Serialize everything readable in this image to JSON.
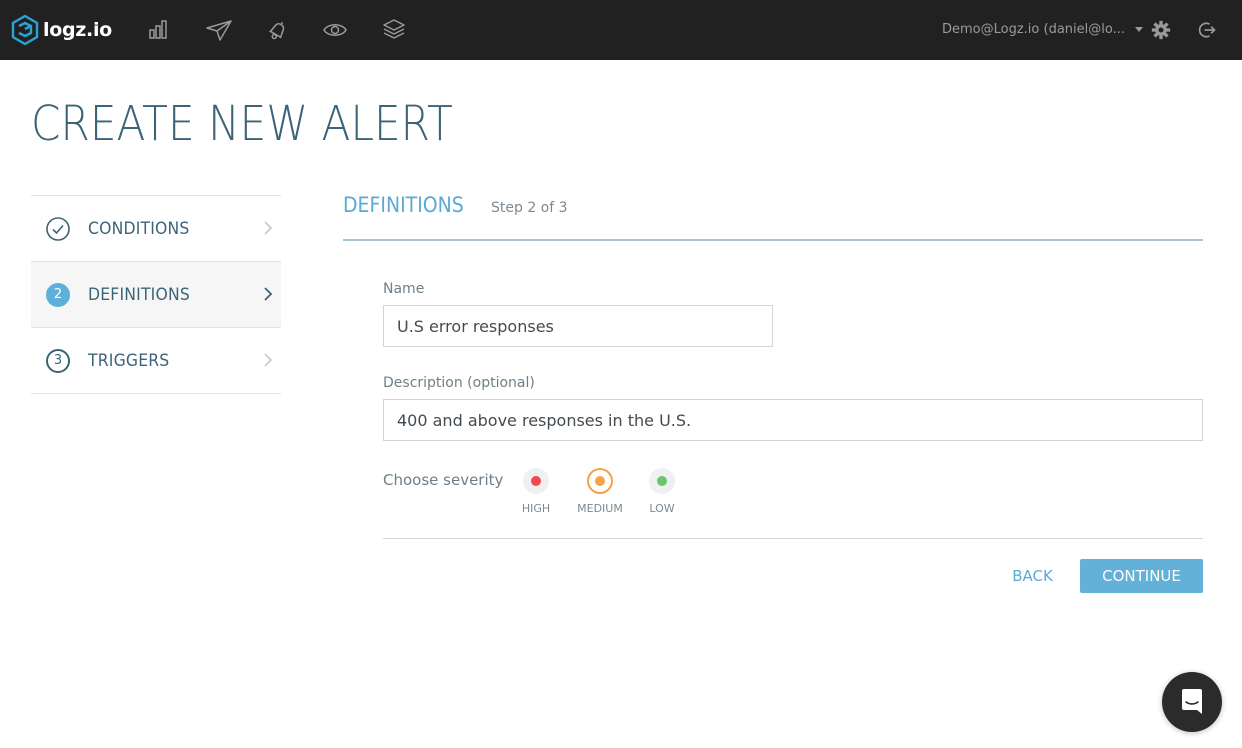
{
  "topbar": {
    "brand": "logz.io",
    "nav_icons": [
      "bar-chart-icon",
      "paper-plane-icon",
      "bell-icon",
      "eye-icon",
      "layers-icon"
    ],
    "account_label": "Demo@Logz.io (daniel@lo...",
    "settings_icon": "gear-icon",
    "logout_icon": "logout-icon"
  },
  "page": {
    "title": "CREATE NEW ALERT"
  },
  "steps": [
    {
      "label": "CONDITIONS",
      "badge": "✓",
      "state": "completed"
    },
    {
      "label": "DEFINITIONS",
      "badge": "2",
      "state": "active"
    },
    {
      "label": "TRIGGERS",
      "badge": "3",
      "state": "pending"
    }
  ],
  "section": {
    "title": "DEFINITIONS",
    "step_text": "Step 2 of 3"
  },
  "form": {
    "name_label": "Name",
    "name_value": "U.S error responses",
    "description_label": "Description (optional)",
    "description_value": "400 and above responses in the U.S.",
    "severity_label": "Choose severity",
    "severities": [
      {
        "label": "HIGH",
        "color": "#f2474e",
        "selected": false
      },
      {
        "label": "MEDIUM",
        "color": "#f5a445",
        "selected": true
      },
      {
        "label": "LOW",
        "color": "#6cc56b",
        "selected": false
      }
    ]
  },
  "actions": {
    "back_label": "BACK",
    "continue_label": "CONTINUE"
  },
  "colors": {
    "accent": "#5aaad5",
    "topbar": "#212121",
    "title": "#3b6478"
  }
}
